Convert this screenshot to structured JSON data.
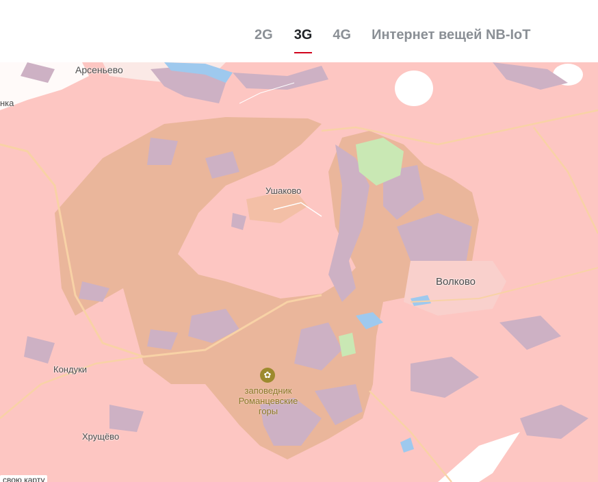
{
  "tabs": [
    {
      "label": "2G",
      "active": false
    },
    {
      "label": "3G",
      "active": true
    },
    {
      "label": "4G",
      "active": false
    },
    {
      "label": "Интернет вещей NB-IoT",
      "active": false
    }
  ],
  "map": {
    "places": {
      "arsenyevo": "Арсеньево",
      "partial_left": "нка",
      "ushakovo": "Ушаково",
      "volkovo": "Волково",
      "kondyki": "Кондуки",
      "khrushchevo": "Хрущёво"
    },
    "reserve": {
      "line1": "заповедник",
      "line2": "Романцевские",
      "line3": "горы",
      "icon": "nature-reserve-icon"
    },
    "credit": "свою карту"
  },
  "colors": {
    "coverage_2g": "#fdc6c2",
    "coverage_3g": "#e6b394",
    "forest": "#cdb1c4",
    "water": "#9ec9ee",
    "park": "#c9e8b4",
    "accent": "#d0021b"
  }
}
